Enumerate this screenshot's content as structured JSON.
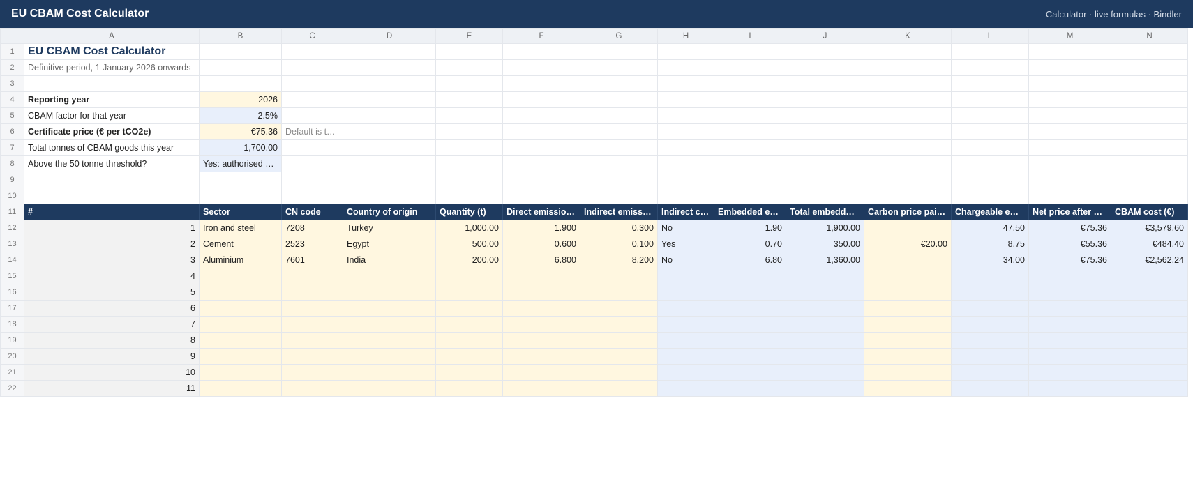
{
  "app": {
    "title": "EU CBAM Cost Calculator",
    "subtitle": "Calculator · live formulas · Bindler"
  },
  "columns": [
    "A",
    "B",
    "C",
    "D",
    "E",
    "F",
    "G",
    "H",
    "I",
    "J",
    "K",
    "L",
    "M",
    "N"
  ],
  "sheet": {
    "title": "EU CBAM Cost Calculator",
    "subtitle": "Definitive period, 1 January 2026 onwards",
    "params": [
      {
        "label": "Reporting year",
        "value": "2026",
        "note": ""
      },
      {
        "label": "CBAM factor for that year",
        "value": "2.5%",
        "note": ""
      },
      {
        "label": "Certificate price (€ per tCO2e)",
        "value": "€75.36",
        "note": "Default is t…"
      },
      {
        "label": "Total tonnes of CBAM goods this year",
        "value": "1,700.00",
        "note": ""
      },
      {
        "label": "Above the 50 tonne threshold?",
        "value": "Yes: authorised …",
        "note": ""
      }
    ],
    "table_headers": [
      "#",
      "Sector",
      "CN code",
      "Country of origin",
      "Quantity (t)",
      "Direct emissio…",
      "Indirect emissi…",
      "Indirect c…",
      "Embedded e…",
      "Total embedd…",
      "Carbon price pai…",
      "Chargeable e…",
      "Net price after …",
      "CBAM cost (€)"
    ],
    "rows": [
      [
        "1",
        "Iron and steel",
        "7208",
        "Turkey",
        "1,000.00",
        "1.900",
        "0.300",
        "No",
        "1.90",
        "1,900.00",
        "",
        "47.50",
        "€75.36",
        "€3,579.60"
      ],
      [
        "2",
        "Cement",
        "2523",
        "Egypt",
        "500.00",
        "0.600",
        "0.100",
        "Yes",
        "0.70",
        "350.00",
        "€20.00",
        "8.75",
        "€55.36",
        "€484.40"
      ],
      [
        "3",
        "Aluminium",
        "7601",
        "India",
        "200.00",
        "6.800",
        "8.200",
        "No",
        "6.80",
        "1,360.00",
        "",
        "34.00",
        "€75.36",
        "€2,562.24"
      ],
      [
        "4",
        "",
        "",
        "",
        "",
        "",
        "",
        "",
        "",
        "",
        "",
        "",
        "",
        ""
      ],
      [
        "5",
        "",
        "",
        "",
        "",
        "",
        "",
        "",
        "",
        "",
        "",
        "",
        "",
        ""
      ],
      [
        "6",
        "",
        "",
        "",
        "",
        "",
        "",
        "",
        "",
        "",
        "",
        "",
        "",
        ""
      ],
      [
        "7",
        "",
        "",
        "",
        "",
        "",
        "",
        "",
        "",
        "",
        "",
        "",
        "",
        ""
      ],
      [
        "8",
        "",
        "",
        "",
        "",
        "",
        "",
        "",
        "",
        "",
        "",
        "",
        "",
        ""
      ],
      [
        "9",
        "",
        "",
        "",
        "",
        "",
        "",
        "",
        "",
        "",
        "",
        "",
        "",
        ""
      ],
      [
        "10",
        "",
        "",
        "",
        "",
        "",
        "",
        "",
        "",
        "",
        "",
        "",
        "",
        ""
      ],
      [
        "11",
        "",
        "",
        "",
        "",
        "",
        "",
        "",
        "",
        "",
        "",
        "",
        "",
        ""
      ]
    ]
  },
  "colors": {
    "header_bg": "#1e3a5f",
    "input_fill": "#fff7e0",
    "output_fill": "#e8effb"
  }
}
